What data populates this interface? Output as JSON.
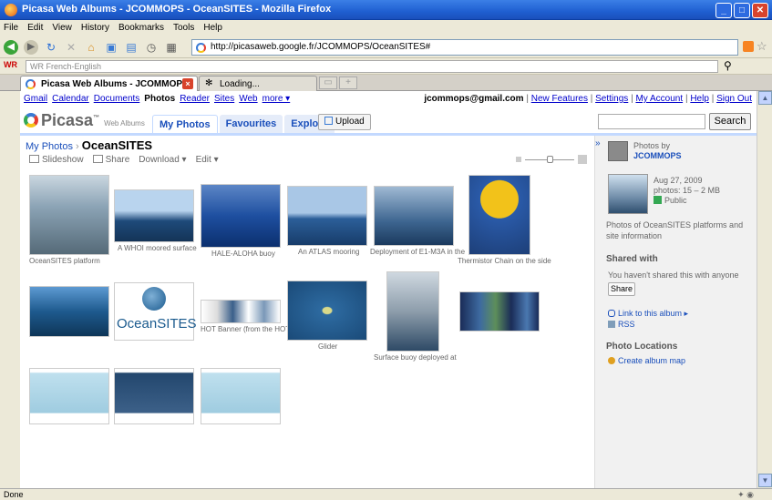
{
  "window": {
    "title": "Picasa Web Albums - JCOMMOPS - OceanSITES - Mozilla Firefox"
  },
  "menu": [
    "File",
    "Edit",
    "View",
    "History",
    "Bookmarks",
    "Tools",
    "Help"
  ],
  "nav": {
    "url": "http://picasaweb.google.fr/JCOMMOPS/OceanSITES#"
  },
  "searchbar": {
    "logo": "WR",
    "placeholder": "WR French-English"
  },
  "tabs": [
    {
      "label": "Picasa Web Albums - JCOMMOPS ..."
    },
    {
      "label": "Loading..."
    }
  ],
  "gbar": {
    "links": [
      "Gmail",
      "Calendar",
      "Documents",
      "Photos",
      "Reader",
      "Sites",
      "Web",
      "more ▾"
    ],
    "current": "Photos"
  },
  "userbar": {
    "email": "jcommops@gmail.com",
    "links": [
      "New Features",
      "Settings",
      "My Account",
      "Help",
      "Sign Out"
    ]
  },
  "header": {
    "logo": "Picasa",
    "logo_tm": "™",
    "logo_sub": "Web Albums",
    "tabs": [
      "My Photos",
      "Favourites",
      "Explore"
    ],
    "upload": "Upload",
    "search_button": "Search"
  },
  "breadcrumb": {
    "parent": "My Photos",
    "sep": " › ",
    "current": "OceanSITES"
  },
  "toolbar": {
    "slideshow": "Slideshow",
    "share": "Share",
    "download": "Download ▾",
    "edit": "Edit ▾"
  },
  "photos": [
    {
      "caption": "OceanSITES platform"
    },
    {
      "caption": "A WHOI moored surface"
    },
    {
      "caption": "HALE-ALOHA buoy"
    },
    {
      "caption": "An ATLAS mooring"
    },
    {
      "caption": "Deployment of E1-M3A in the"
    },
    {
      "caption": "Thermistor Chain on the side"
    },
    {
      "caption": ""
    },
    {
      "caption": ""
    },
    {
      "caption": "HOT Banner (from the HOT"
    },
    {
      "caption": "Glider"
    },
    {
      "caption": "Surface buoy deployed at"
    },
    {
      "caption": ""
    },
    {
      "caption": ""
    },
    {
      "caption": ""
    },
    {
      "caption": ""
    }
  ],
  "sidebar": {
    "photos_by": "Photos by",
    "owner": "JCOMMOPS",
    "date": "Aug 27, 2009",
    "count": "photos: 15 – 2 MB",
    "visibility": "Public",
    "description": "Photos of OceanSITES platforms and site information",
    "shared_title": "Shared with",
    "shared_text": "You haven't shared this with anyone",
    "share_button": "Share",
    "link_album": "Link to this album ▸",
    "rss": "RSS",
    "locations_title": "Photo Locations",
    "create_map": "Create album map"
  },
  "logo_text": "OceanSITES",
  "status": {
    "text": "Done"
  }
}
